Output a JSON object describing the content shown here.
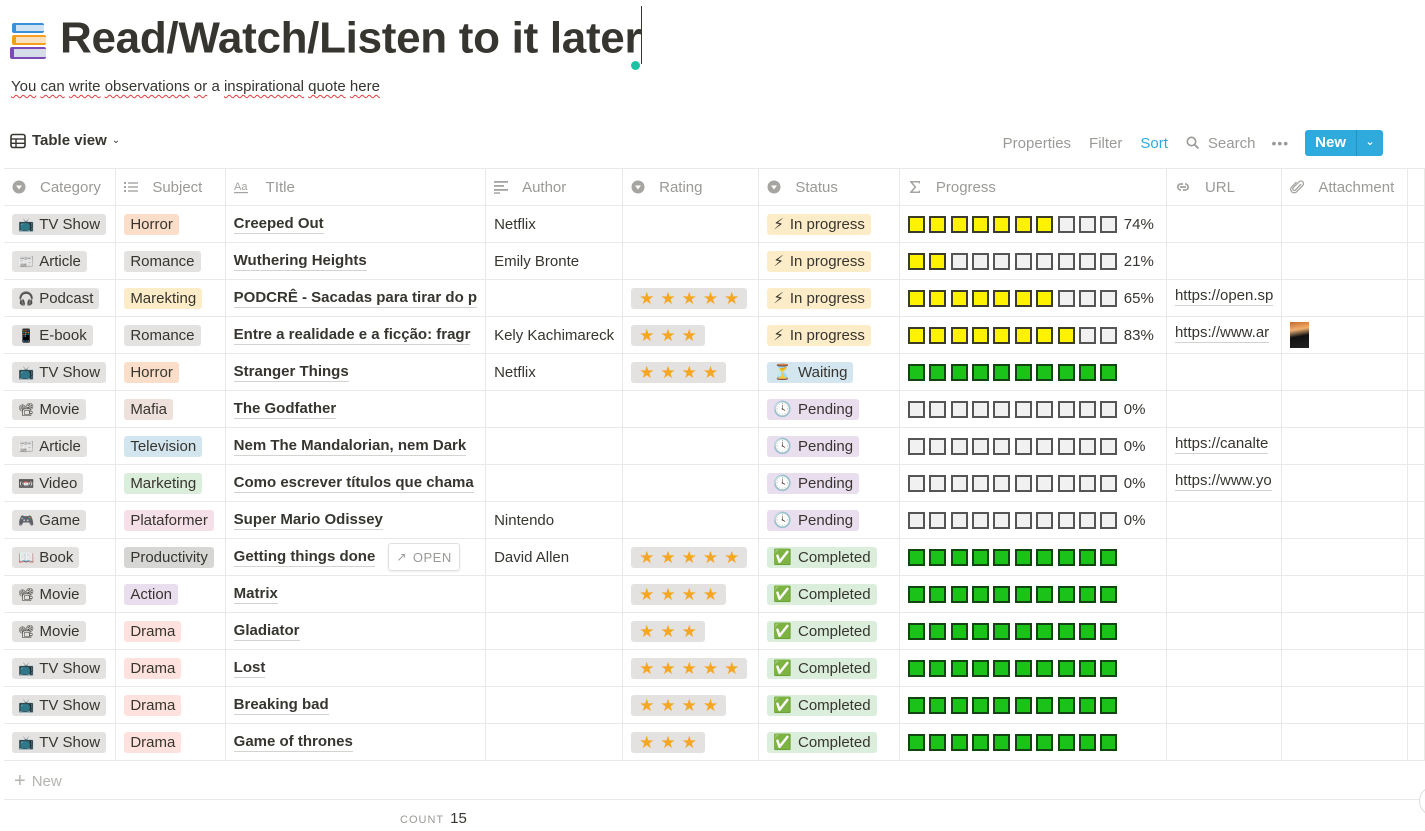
{
  "page": {
    "icon": "books-icon",
    "title": "Read/Watch/Listen to it later",
    "subtitle_words": [
      "You",
      "can",
      "write",
      "observations",
      "or",
      "a",
      "inspirational",
      "quote",
      "here"
    ]
  },
  "toolbar": {
    "view_label": "Table view",
    "properties": "Properties",
    "filter": "Filter",
    "sort": "Sort",
    "search": "Search",
    "more": "•••",
    "new_label": "New",
    "accent_color": "#2eaadc"
  },
  "columns": [
    {
      "key": "category",
      "label": "Category",
      "icon": "select-icon"
    },
    {
      "key": "subject",
      "label": "Subject",
      "icon": "multi-select-icon"
    },
    {
      "key": "title",
      "label": "TItle",
      "icon": "text-aa-icon"
    },
    {
      "key": "author",
      "label": "Author",
      "icon": "text-lines-icon"
    },
    {
      "key": "rating",
      "label": "Rating",
      "icon": "select-icon"
    },
    {
      "key": "status",
      "label": "Status",
      "icon": "select-icon"
    },
    {
      "key": "progress",
      "label": "Progress",
      "icon": "formula-sigma-icon"
    },
    {
      "key": "url",
      "label": "URL",
      "icon": "link-icon"
    },
    {
      "key": "attachment",
      "label": "Attachment",
      "icon": "paperclip-icon"
    }
  ],
  "categories": {
    "TV Show": {
      "emoji": "📺"
    },
    "Article": {
      "emoji": "📰"
    },
    "Podcast": {
      "emoji": "🎧"
    },
    "E-book": {
      "emoji": "📱"
    },
    "Movie": {
      "emoji": "📽"
    },
    "Video": {
      "emoji": "📼"
    },
    "Game": {
      "emoji": "🎮"
    },
    "Book": {
      "emoji": "📖"
    }
  },
  "subject_colors": {
    "Horror": "#fadec9",
    "Romance": "#e3e2e0",
    "Marekting": "#fdecc8",
    "Mafia": "#eee0da",
    "Television": "#d3e5ef",
    "Marketing": "#dbeddb",
    "Plataformer": "#f5e0e9",
    "Productivity": "#d6d6d4",
    "Action": "#e8deee",
    "Drama": "#ffe2dd"
  },
  "statuses": {
    "In progress": {
      "emoji": "⚡",
      "bg": "#fdecc8"
    },
    "Waiting": {
      "emoji": "⏳",
      "bg": "#d3e5ef"
    },
    "Pending": {
      "emoji": "🕓",
      "bg": "#e8deee"
    },
    "Completed": {
      "emoji": "✅",
      "bg": "#dbeddb"
    }
  },
  "rows": [
    {
      "category": "TV Show",
      "subject": "Horror",
      "title": "Creeped Out",
      "author": "Netflix",
      "rating": 0,
      "status": "In progress",
      "progress": 74,
      "progress_label": "74%",
      "url": "",
      "attachment": false
    },
    {
      "category": "Article",
      "subject": "Romance",
      "title": "Wuthering Heights",
      "author": "Emily Bronte",
      "rating": 0,
      "status": "In progress",
      "progress": 21,
      "progress_label": "21%",
      "url": "",
      "attachment": false
    },
    {
      "category": "Podcast",
      "subject": "Marekting",
      "title": "PODCRÊ - Sacadas para tirar do p",
      "author": "",
      "rating": 5,
      "status": "In progress",
      "progress": 65,
      "progress_label": "65%",
      "url": "https://open.sp",
      "attachment": false
    },
    {
      "category": "E-book",
      "subject": "Romance",
      "title": "Entre a realidade e a ficção: fragr",
      "author": "Kely Kachimareck",
      "rating": 3,
      "status": "In progress",
      "progress": 83,
      "progress_label": "83%",
      "url": "https://www.ar",
      "attachment": true
    },
    {
      "category": "TV Show",
      "subject": "Horror",
      "title": "Stranger Things",
      "author": "Netflix",
      "rating": 4,
      "status": "Waiting",
      "progress": 100,
      "progress_label": "",
      "url": "",
      "attachment": false
    },
    {
      "category": "Movie",
      "subject": "Mafia",
      "title": "The Godfather",
      "author": "",
      "rating": 0,
      "status": "Pending",
      "progress": 0,
      "progress_label": "0%",
      "url": "",
      "attachment": false
    },
    {
      "category": "Article",
      "subject": "Television",
      "title": "Nem The Mandalorian, nem Dark",
      "author": "",
      "rating": 0,
      "status": "Pending",
      "progress": 0,
      "progress_label": "0%",
      "url": "https://canalte",
      "attachment": false
    },
    {
      "category": "Video",
      "subject": "Marketing",
      "title": "Como escrever títulos que chama",
      "author": "",
      "rating": 0,
      "status": "Pending",
      "progress": 0,
      "progress_label": "0%",
      "url": "https://www.yo",
      "attachment": false
    },
    {
      "category": "Game",
      "subject": "Plataformer",
      "title": "Super Mario Odissey",
      "author": "Nintendo",
      "rating": 0,
      "status": "Pending",
      "progress": 0,
      "progress_label": "0%",
      "url": "",
      "attachment": false
    },
    {
      "category": "Book",
      "subject": "Productivity",
      "title": "Getting things done",
      "author": "David Allen",
      "rating": 5,
      "status": "Completed",
      "progress": 100,
      "progress_label": "",
      "url": "",
      "attachment": false,
      "hover_open": "OPEN"
    },
    {
      "category": "Movie",
      "subject": "Action",
      "title": "Matrix",
      "author": "",
      "rating": 4,
      "status": "Completed",
      "progress": 100,
      "progress_label": "",
      "url": "",
      "attachment": false
    },
    {
      "category": "Movie",
      "subject": "Drama",
      "title": "Gladiator",
      "author": "",
      "rating": 3,
      "status": "Completed",
      "progress": 100,
      "progress_label": "",
      "url": "",
      "attachment": false
    },
    {
      "category": "TV Show",
      "subject": "Drama",
      "title": "Lost",
      "author": "",
      "rating": 5,
      "status": "Completed",
      "progress": 100,
      "progress_label": "",
      "url": "",
      "attachment": false
    },
    {
      "category": "TV Show",
      "subject": "Drama",
      "title": "Breaking bad",
      "author": "",
      "rating": 4,
      "status": "Completed",
      "progress": 100,
      "progress_label": "",
      "url": "",
      "attachment": false
    },
    {
      "category": "TV Show",
      "subject": "Drama",
      "title": "Game of thrones",
      "author": "",
      "rating": 3,
      "status": "Completed",
      "progress": 100,
      "progress_label": "",
      "url": "",
      "attachment": false
    }
  ],
  "footer": {
    "add_label": "New",
    "count_label": "COUNT",
    "count_value": "15"
  }
}
